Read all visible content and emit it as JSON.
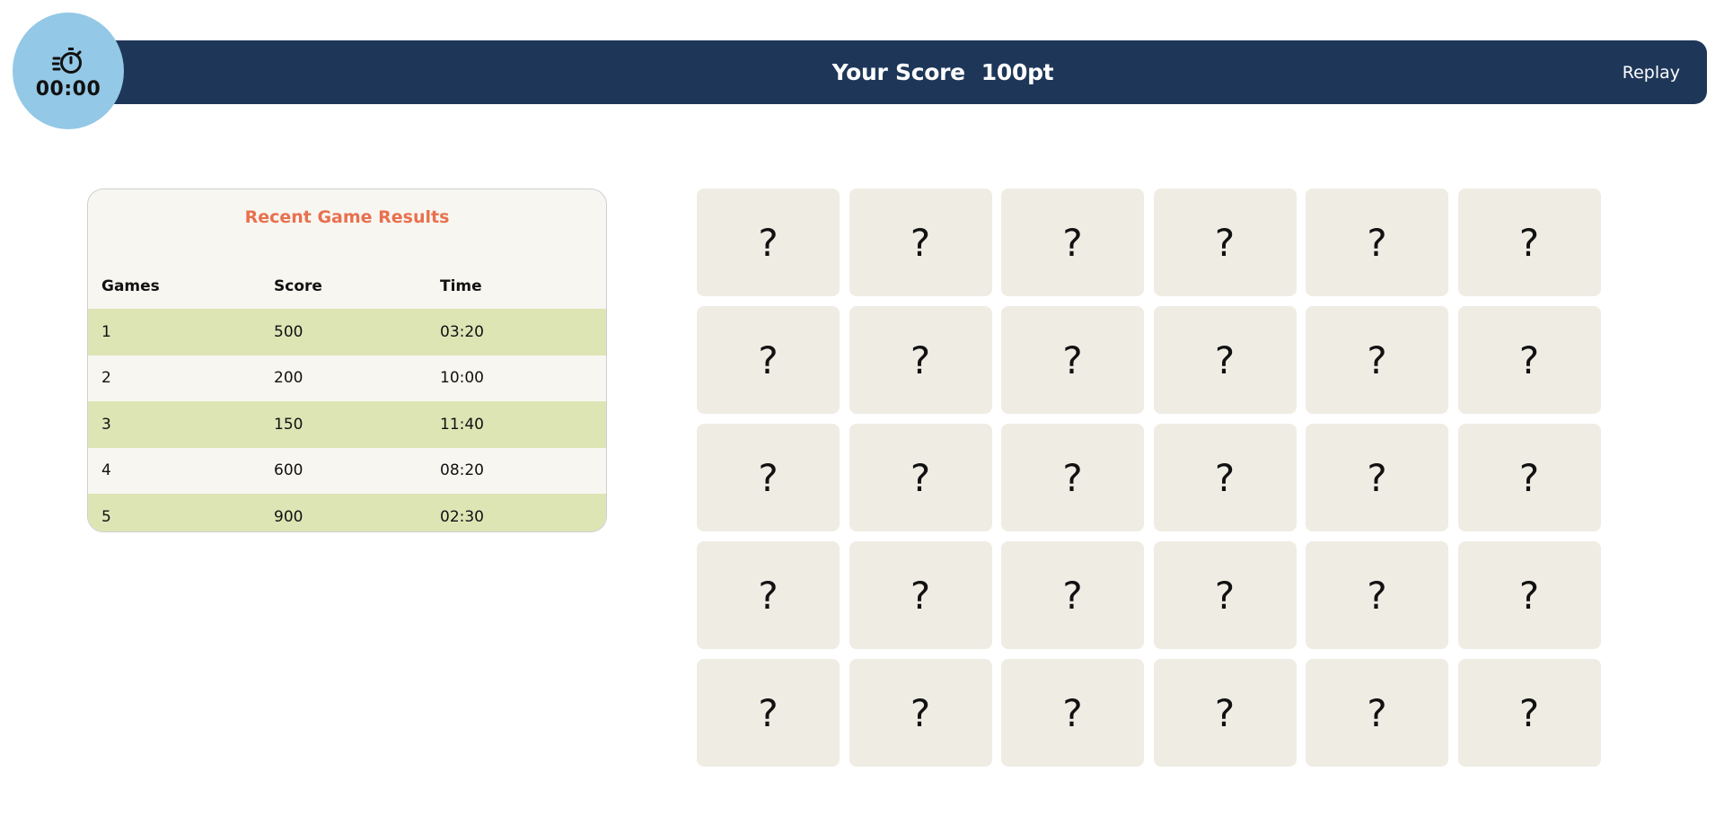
{
  "timer": {
    "icon": "stopwatch-icon",
    "value": "00:00"
  },
  "header": {
    "score_label": "Your Score",
    "score_value": "100pt",
    "replay_label": "Replay"
  },
  "results": {
    "title": "Recent Game Results",
    "columns": [
      "Games",
      "Score",
      "Time"
    ],
    "rows": [
      [
        "1",
        "500",
        "03:20"
      ],
      [
        "2",
        "200",
        "10:00"
      ],
      [
        "3",
        "150",
        "11:40"
      ],
      [
        "4",
        "600",
        "08:20"
      ],
      [
        "5",
        "900",
        "02:30"
      ]
    ]
  },
  "board": {
    "columns": 6,
    "cards": [
      "?",
      "?",
      "?",
      "?",
      "?",
      "?",
      "?",
      "?",
      "?",
      "?",
      "?",
      "?",
      "?",
      "?",
      "?",
      "?",
      "?",
      "?",
      "?",
      "?",
      "?",
      "?",
      "?",
      "?",
      "?",
      "?",
      "?",
      "?",
      "?",
      "?"
    ]
  },
  "colors": {
    "header_bg": "#1e3759",
    "timer_bg": "#93c8e6",
    "title_accent": "#e8704f",
    "row_highlight": "#dde5b5",
    "card_bg": "#efece4"
  }
}
